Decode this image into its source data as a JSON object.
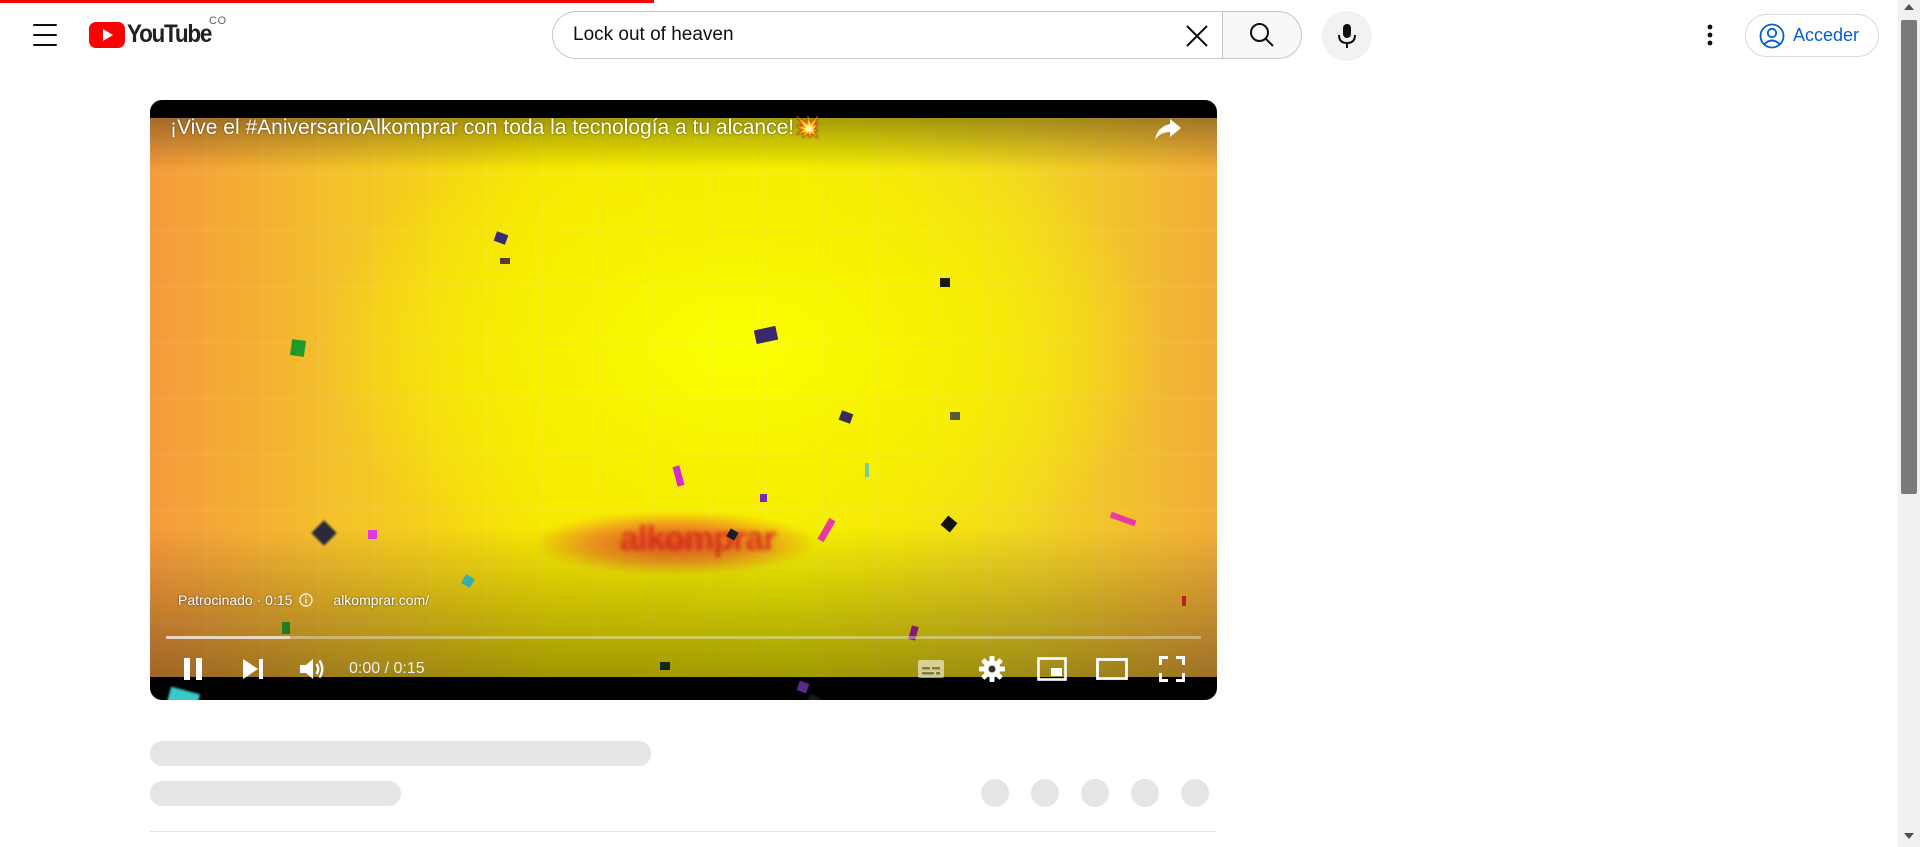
{
  "header": {
    "logo_text": "YouTube",
    "country_code": "CO",
    "search_value": "Lock out of heaven",
    "signin_label": "Acceder"
  },
  "player": {
    "ad_title": "¡Vive el #AniversarioAlkomprar con toda la tecnología a tu alcance!💥",
    "sponsored_label": "Patrocinado · 0:15",
    "ad_url": "alkomprar.com/",
    "time_display": "0:00 / 0:15",
    "progress_played": 0.0,
    "progress_buffered": 0.12
  },
  "icons": [
    "menu-icon",
    "youtube-logo-icon",
    "close-icon",
    "search-icon",
    "mic-icon",
    "more-vert-icon",
    "account-icon",
    "share-icon",
    "info-icon",
    "pause-icon",
    "next-icon",
    "volume-icon",
    "subtitles-icon",
    "settings-icon",
    "miniplayer-icon",
    "theater-icon",
    "fullscreen-icon"
  ],
  "colors": {
    "brand_red": "#ff0000",
    "link_blue": "#065fd4",
    "skeleton": "#e5e5e5"
  }
}
